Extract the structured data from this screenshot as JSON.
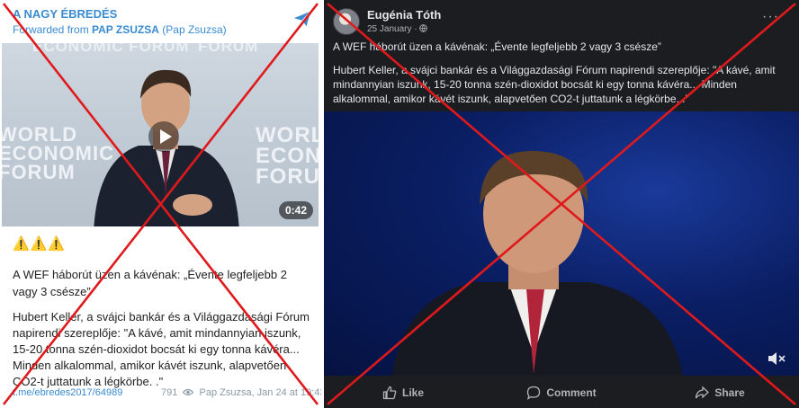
{
  "telegram": {
    "channel_name": "A NAGY ÉBREDÉS",
    "forwarded_prefix": "Forwarded from ",
    "forwarded_from": "PAP ZSUZSA",
    "forwarded_from_sub": " (Pap Zsuzsa)",
    "video_bg_words": [
      "ECONOMIC FORUM",
      "FORUM",
      "WORLD ECONOMIC FORUM",
      "WORLD ECONOMIC FORUM"
    ],
    "video_duration": "0:42",
    "warning_emojis": "⚠️⚠️⚠️",
    "title": "A WEF háborút üzen a kávénak: „Évente legfeljebb 2 vagy 3 csésze”",
    "body": "Hubert Keller, a svájci bankár és a Világgazdasági Fórum napirendi szereplője: \"A kávé, amit mindannyian iszunk, 15-20 tonna szén-dioxidot bocsát ki egy tonna kávéra... Minden alkalommal, amikor kávét iszunk, alapvetően CO2-t juttatunk a légkörbe. .\"",
    "link": "t.me/ebredes2017/64989",
    "views": "791",
    "author_date": "Pap Zsuzsa, Jan 24 at 19:43"
  },
  "facebook": {
    "author": "Eugénia Tóth",
    "date": "25 January · ",
    "title": "A WEF háborút üzen a kávénak: „Évente legfeljebb 2 vagy 3 csésze”",
    "body": "Hubert Keller, a svájci bankár és a Világgazdasági Fórum napirendi szereplője: \"A kávé, amit mindannyian iszunk, 15-20 tonna szén-dioxidot bocsát ki egy tonna kávéra... Minden alkalommal, amikor kávét iszunk, alapvetően CO2-t juttatunk a légkörbe. .\"",
    "actions": {
      "like": "Like",
      "comment": "Comment",
      "share": "Share"
    }
  },
  "colors": {
    "telegram_accent": "#3a8bd0",
    "facebook_bg": "#1b1d20",
    "cross_red": "#e0191c"
  }
}
